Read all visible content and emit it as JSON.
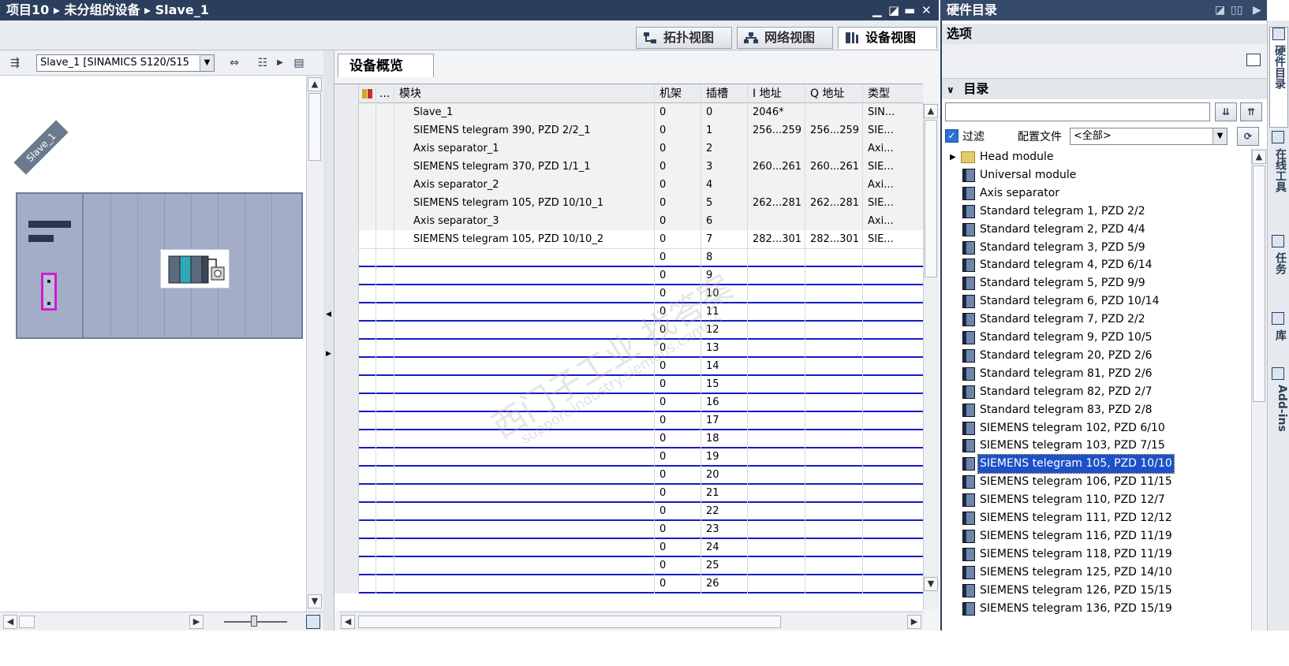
{
  "title_bar": {
    "breadcrumb": "项目10 ▸ 未分组的设备 ▸ Slave_1"
  },
  "view_tabs": [
    {
      "label": "拓扑视图",
      "icon": "topology-icon",
      "active": false
    },
    {
      "label": "网络视图",
      "icon": "network-icon",
      "active": false
    },
    {
      "label": "设备视图",
      "icon": "device-icon",
      "active": true
    }
  ],
  "device_view": {
    "selector_value": "Slave_1 [SINAMICS S120/S15",
    "rack_label": "Slave_1"
  },
  "overview": {
    "tab_label": "设备概览",
    "columns": [
      "...",
      "模块",
      "机架",
      "插槽",
      "I 地址",
      "Q 地址",
      "类型"
    ],
    "rows": [
      {
        "module": "Slave_1",
        "rack": "0",
        "slot": "0",
        "i_addr": "2046*",
        "q_addr": "",
        "type": "SIN..."
      },
      {
        "module": "SIEMENS telegram 390, PZD 2/2_1",
        "rack": "0",
        "slot": "1",
        "i_addr": "256...259",
        "q_addr": "256...259",
        "type": "SIE..."
      },
      {
        "module": "Axis separator_1",
        "rack": "0",
        "slot": "2",
        "i_addr": "",
        "q_addr": "",
        "type": "Axi..."
      },
      {
        "module": "SIEMENS telegram 370, PZD 1/1_1",
        "rack": "0",
        "slot": "3",
        "i_addr": "260...261",
        "q_addr": "260...261",
        "type": "SIE..."
      },
      {
        "module": "Axis separator_2",
        "rack": "0",
        "slot": "4",
        "i_addr": "",
        "q_addr": "",
        "type": "Axi..."
      },
      {
        "module": "SIEMENS telegram 105, PZD 10/10_1",
        "rack": "0",
        "slot": "5",
        "i_addr": "262...281",
        "q_addr": "262...281",
        "type": "SIE..."
      },
      {
        "module": "Axis separator_3",
        "rack": "0",
        "slot": "6",
        "i_addr": "",
        "q_addr": "",
        "type": "Axi..."
      },
      {
        "module": "SIEMENS telegram 105, PZD 10/10_2",
        "rack": "0",
        "slot": "7",
        "i_addr": "282...301",
        "q_addr": "282...301",
        "type": "SIE..."
      }
    ],
    "empty_slots": [
      "8",
      "9",
      "10",
      "11",
      "12",
      "13",
      "14",
      "15",
      "16",
      "17",
      "18",
      "19",
      "20",
      "21",
      "22",
      "23",
      "24",
      "25",
      "26"
    ],
    "empty_rack": "0"
  },
  "catalog": {
    "title": "硬件目录",
    "options_label": "选项",
    "catalog_label": "目录",
    "search_value": "",
    "filter_label": "过滤",
    "profile_label": "配置文件",
    "profile_value": "<全部>",
    "items": [
      {
        "label": "Head module",
        "kind": "folder"
      },
      {
        "label": "Universal module",
        "kind": "module"
      },
      {
        "label": "Axis separator",
        "kind": "module"
      },
      {
        "label": "Standard telegram 1, PZD 2/2",
        "kind": "module"
      },
      {
        "label": "Standard telegram 2, PZD 4/4",
        "kind": "module"
      },
      {
        "label": "Standard telegram 3, PZD 5/9",
        "kind": "module"
      },
      {
        "label": "Standard telegram 4, PZD 6/14",
        "kind": "module"
      },
      {
        "label": "Standard telegram 5, PZD 9/9",
        "kind": "module"
      },
      {
        "label": "Standard telegram 6, PZD 10/14",
        "kind": "module"
      },
      {
        "label": "Standard telegram 7, PZD 2/2",
        "kind": "module"
      },
      {
        "label": "Standard telegram 9, PZD 10/5",
        "kind": "module"
      },
      {
        "label": "Standard telegram 20, PZD 2/6",
        "kind": "module"
      },
      {
        "label": "Standard telegram 81, PZD 2/6",
        "kind": "module"
      },
      {
        "label": "Standard telegram 82, PZD 2/7",
        "kind": "module"
      },
      {
        "label": "Standard telegram 83, PZD 2/8",
        "kind": "module"
      },
      {
        "label": "SIEMENS telegram 102, PZD 6/10",
        "kind": "module"
      },
      {
        "label": "SIEMENS telegram 103, PZD 7/15",
        "kind": "module"
      },
      {
        "label": "SIEMENS telegram 105, PZD 10/10",
        "kind": "module",
        "selected": true
      },
      {
        "label": "SIEMENS telegram 106, PZD 11/15",
        "kind": "module"
      },
      {
        "label": "SIEMENS telegram 110, PZD 12/7",
        "kind": "module"
      },
      {
        "label": "SIEMENS telegram 111, PZD 12/12",
        "kind": "module"
      },
      {
        "label": "SIEMENS telegram 116, PZD 11/19",
        "kind": "module"
      },
      {
        "label": "SIEMENS telegram 118, PZD 11/19",
        "kind": "module"
      },
      {
        "label": "SIEMENS telegram 125, PZD 14/10",
        "kind": "module"
      },
      {
        "label": "SIEMENS telegram 126, PZD 15/15",
        "kind": "module"
      },
      {
        "label": "SIEMENS telegram 136, PZD 15/19",
        "kind": "module"
      }
    ]
  },
  "side_dock": [
    {
      "label": "硬件目录",
      "icon": "catalog-icon",
      "active": true
    },
    {
      "label": "在线工具",
      "icon": "online-tools-icon",
      "active": false
    },
    {
      "label": "任务",
      "icon": "tasks-icon",
      "active": false
    },
    {
      "label": "库",
      "icon": "library-icon",
      "active": false
    },
    {
      "label": "Add-ins",
      "icon": "add-ins-icon",
      "active": false
    }
  ],
  "watermark": {
    "line1": "西门子工业 找答案",
    "line2": "support.industry.siemens.com/cs"
  },
  "colors": {
    "title_bar": "#2b3f5c",
    "selection": "#1e50c8",
    "empty_row_line": "#1919c8",
    "rack": "#a4adc8"
  }
}
